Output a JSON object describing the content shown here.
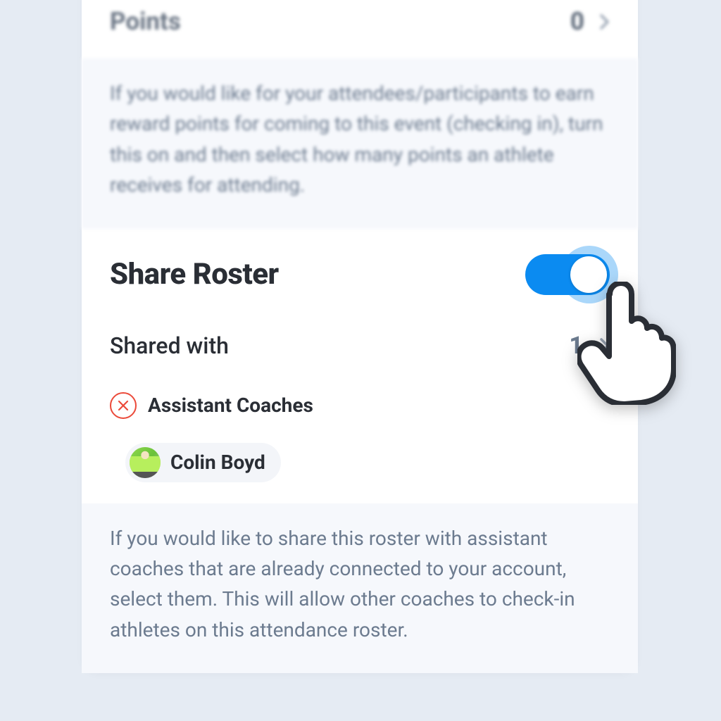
{
  "points": {
    "label": "Points",
    "value": "0",
    "hint": "If you would like for your attendees/participants to earn reward points for coming to this event (checking in), turn this on and then select how many points an athlete receives for attending."
  },
  "share": {
    "title": "Share Roster",
    "toggle_on": true,
    "shared_with_label": "Shared with",
    "shared_with_count": "1",
    "group_label": "Assistant Coaches",
    "people": [
      {
        "name": "Colin Boyd"
      }
    ],
    "hint": "If you would like to share this roster with assistant coaches that are already connected to your account, select them. This will allow other coaches to check-in athletes on this attendance roster."
  }
}
